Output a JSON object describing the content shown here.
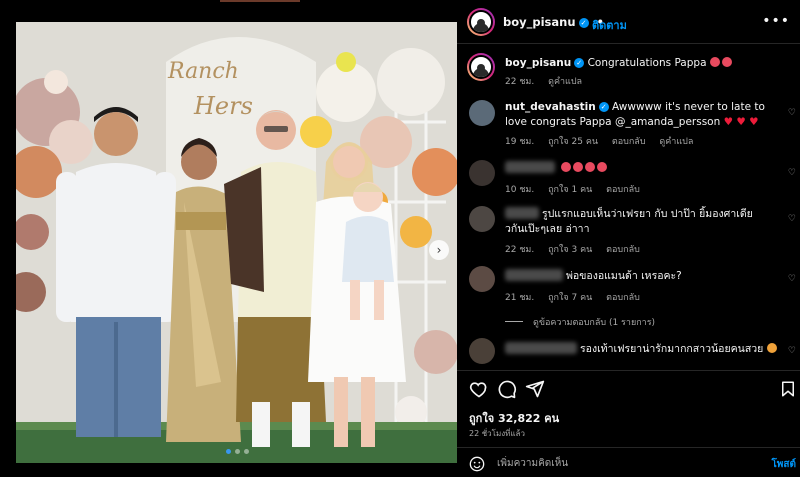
{
  "post": {
    "username": "boy_pisanu",
    "follow_label": "ติดตาม",
    "dot": "•",
    "more_icon": "more-horizontal-icon",
    "media": {
      "sign_line1": "Ranch",
      "sign_line2": "Hers",
      "next_icon": "chevron-right-icon"
    },
    "caption": {
      "username": "boy_pisanu",
      "text": "Congratulations Pappa",
      "age": "22 ชม.",
      "translate": "ดูคำแปล"
    },
    "comments": [
      {
        "username": "nut_devahastin",
        "text": "Awwwww it's never to late to love congrats Pappa @_amanda_persson",
        "hearts": "♥ ♥ ♥",
        "age": "19 ชม.",
        "likes": "ถูกใจ 25 คน",
        "reply": "ตอบกลับ",
        "translate": "ดูคำแปล"
      },
      {
        "text": "",
        "age": "10 ชม.",
        "likes": "ถูกใจ 1 คน",
        "reply": "ตอบกลับ"
      },
      {
        "text": "รูปแรกแอบเห็นว่าเฟรยา กับ ปาป๊า ยิ้มองศาเดียวกันเป๊ะๆเลย อ่าาา",
        "age": "22 ชม.",
        "likes": "ถูกใจ 3 คน",
        "reply": "ตอบกลับ"
      },
      {
        "text": "พ่อของอแมนด้า เหรอคะ?",
        "age": "21 ชม.",
        "likes": "ถูกใจ 7 คน",
        "reply": "ตอบกลับ",
        "view_replies": "ดูข้อความตอบกลับ (1 รายการ)"
      },
      {
        "text": "รองเท้าเฟรยาน่ารักมากกสาวน้อยคนสวย"
      }
    ],
    "actions": {
      "like_icon": "heart-icon",
      "comment_icon": "comment-icon",
      "share_icon": "share-icon",
      "save_icon": "bookmark-icon"
    },
    "likes_count": "ถูกใจ 32,822 คน",
    "time_ago": "22 ชั่วโมงที่แล้ว",
    "add_comment": {
      "placeholder": "เพิ่มความคิดเห็น",
      "post_label": "โพสต์"
    }
  },
  "colors": {
    "accent": "#0095f6",
    "background": "#000000",
    "muted": "#a8a8a8",
    "heart": "#ed1c3a"
  }
}
